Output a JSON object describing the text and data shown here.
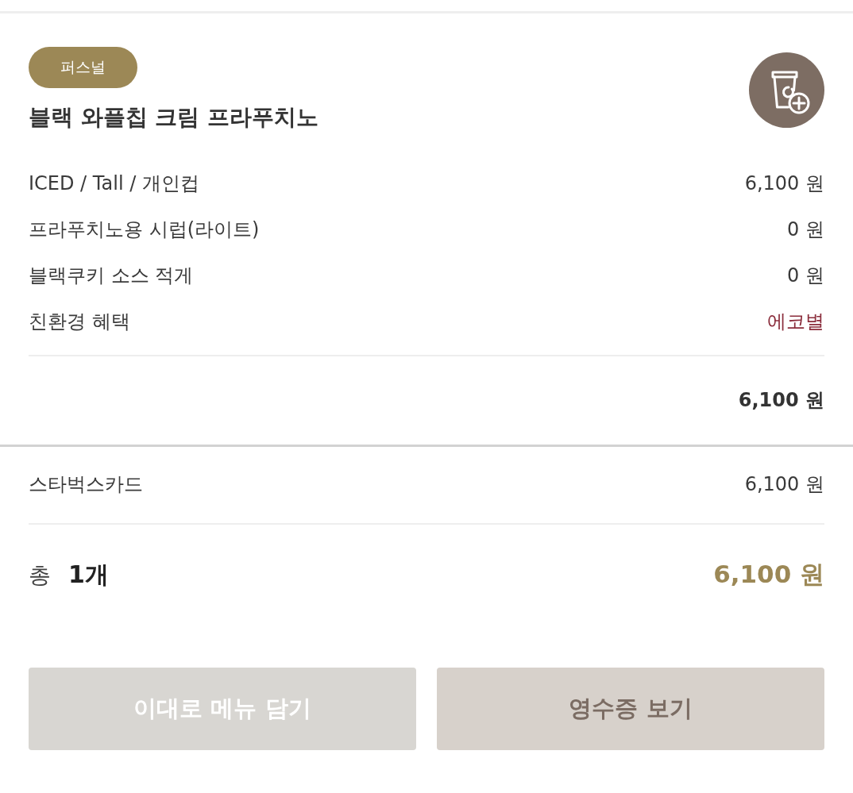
{
  "order_item": {
    "badge": "퍼스널",
    "name": "블랙 와플칩 크림 프라푸치노",
    "options": [
      {
        "kind": "price",
        "label": "ICED / Tall / 개인컵",
        "value": "6,100 원"
      },
      {
        "kind": "price",
        "label": "프라푸치노용 시럽(라이트)",
        "value": "0 원"
      },
      {
        "kind": "price",
        "label": "블랙쿠키 소스 적게",
        "value": "0 원"
      },
      {
        "kind": "benefit",
        "label": "친환경 혜택",
        "value": "에코별"
      }
    ],
    "subtotal": "6,100 원"
  },
  "payments": [
    {
      "method": "스타벅스카드",
      "amount": "6,100 원"
    }
  ],
  "total": {
    "label": "총",
    "count": "1개",
    "amount": "6,100 원"
  },
  "buttons": [
    {
      "label": "이대로 메뉴 담기",
      "disabled": true
    },
    {
      "label": "영수증 보기",
      "disabled": false
    }
  ]
}
